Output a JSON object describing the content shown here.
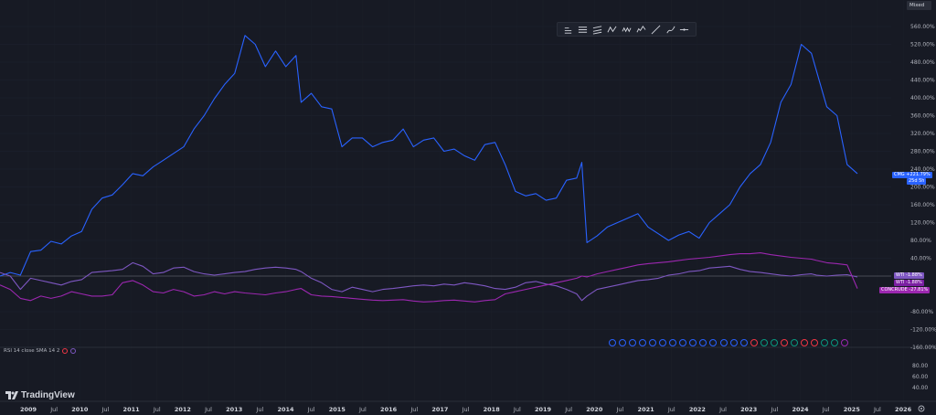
{
  "scale_mode": "Mixed",
  "brand": "TradingView",
  "rsi_legend": "RSI 14 close SMA 14 2",
  "toolbar_icons": [
    "cursor-lines-icon",
    "horizontal-lines-icon",
    "parallel-lines-icon",
    "wave-icon",
    "zigzag-icon",
    "multi-wave-icon",
    "trend-line-icon",
    "brush-icon",
    "hline-icon"
  ],
  "chart_data": {
    "type": "line",
    "price_axis_ticks": [
      "560.00%",
      "520.00%",
      "480.00%",
      "440.00%",
      "400.00%",
      "360.00%",
      "320.00%",
      "280.00%",
      "240.00%",
      "200.00%",
      "160.00%",
      "120.00%",
      "80.00%",
      "40.00%",
      "-80.00%",
      "-120.00%",
      "-160.00%"
    ],
    "rsi_axis_ticks": [
      "80.00",
      "60.00",
      "40.00"
    ],
    "time_labels": [
      "2009",
      "Jul",
      "2010",
      "Jul",
      "2011",
      "Jul",
      "2012",
      "Jul",
      "2013",
      "Jul",
      "2014",
      "Jul",
      "2015",
      "Jul",
      "2016",
      "Jul",
      "2017",
      "Jul",
      "2018",
      "Jul",
      "2019",
      "Jul",
      "2020",
      "Jul",
      "2021",
      "Jul",
      "2022",
      "Jul",
      "2023",
      "Jul",
      "2024",
      "Jul",
      "2025",
      "Jul",
      "2026"
    ],
    "colors": {
      "cmg": "#2962ff",
      "wti1": "#7e57c2",
      "wti2": "#7b1fa2",
      "concrude": "#9c27b0",
      "baseline": "#787b86"
    },
    "series": [
      {
        "name": "CMG",
        "color": "#2962ff",
        "last_label": "+221.79%",
        "countdown": "25d 5h",
        "x": [
          2008.6,
          2008.8,
          2009.0,
          2009.2,
          2009.4,
          2009.6,
          2009.8,
          2010.0,
          2010.2,
          2010.4,
          2010.6,
          2010.8,
          2011.0,
          2011.2,
          2011.4,
          2011.6,
          2011.8,
          2012.0,
          2012.2,
          2012.4,
          2012.6,
          2012.8,
          2013.0,
          2013.2,
          2013.4,
          2013.6,
          2013.8,
          2014.0,
          2014.2,
          2014.4,
          2014.5,
          2014.7,
          2014.9,
          2015.1,
          2015.3,
          2015.5,
          2015.7,
          2015.9,
          2016.1,
          2016.3,
          2016.5,
          2016.7,
          2016.9,
          2017.1,
          2017.3,
          2017.5,
          2017.7,
          2017.9,
          2018.1,
          2018.3,
          2018.5,
          2018.7,
          2018.9,
          2019.1,
          2019.3,
          2019.5,
          2019.7,
          2019.9,
          2020.0,
          2020.1,
          2020.3,
          2020.5,
          2020.7,
          2020.9,
          2021.1,
          2021.3,
          2021.5,
          2021.7,
          2021.9,
          2022.1,
          2022.3,
          2022.5,
          2022.7,
          2022.9,
          2023.1,
          2023.3,
          2023.5,
          2023.7,
          2023.9,
          2024.1,
          2024.3,
          2024.5,
          2024.6,
          2024.8,
          2025.0,
          2025.2,
          2025.4
        ],
        "values": [
          0,
          8,
          2,
          55,
          58,
          78,
          72,
          90,
          100,
          150,
          175,
          182,
          205,
          230,
          225,
          245,
          260,
          275,
          290,
          330,
          360,
          398,
          430,
          455,
          540,
          520,
          470,
          505,
          470,
          495,
          390,
          410,
          380,
          375,
          290,
          310,
          310,
          290,
          300,
          305,
          330,
          290,
          305,
          310,
          280,
          285,
          270,
          260,
          295,
          300,
          250,
          190,
          180,
          185,
          170,
          175,
          215,
          220,
          255,
          75,
          90,
          110,
          120,
          130,
          140,
          110,
          95,
          80,
          92,
          100,
          85,
          120,
          140,
          160,
          200,
          230,
          250,
          300,
          390,
          430,
          520,
          500,
          460,
          380,
          360,
          250,
          230
        ]
      },
      {
        "name": "WTI",
        "color": "#7e57c2",
        "last_label": "-1.88%",
        "x": [
          2008.6,
          2008.8,
          2009.0,
          2009.2,
          2009.4,
          2009.6,
          2009.8,
          2010.0,
          2010.2,
          2010.4,
          2010.6,
          2010.8,
          2011.0,
          2011.2,
          2011.4,
          2011.6,
          2011.8,
          2012.0,
          2012.2,
          2012.4,
          2012.6,
          2012.8,
          2013.0,
          2013.2,
          2013.4,
          2013.6,
          2013.8,
          2014.0,
          2014.2,
          2014.4,
          2014.5,
          2014.7,
          2014.9,
          2015.1,
          2015.3,
          2015.5,
          2015.7,
          2015.9,
          2016.1,
          2016.3,
          2016.5,
          2016.7,
          2016.9,
          2017.1,
          2017.3,
          2017.5,
          2017.7,
          2017.9,
          2018.1,
          2018.3,
          2018.5,
          2018.7,
          2018.9,
          2019.1,
          2019.3,
          2019.5,
          2019.7,
          2019.9,
          2020.0,
          2020.1,
          2020.3,
          2020.5,
          2020.7,
          2020.9,
          2021.1,
          2021.3,
          2021.5,
          2021.7,
          2021.9,
          2022.1,
          2022.3,
          2022.5,
          2022.7,
          2022.9,
          2023.1,
          2023.3,
          2023.5,
          2023.7,
          2023.9,
          2024.1,
          2024.3,
          2024.5,
          2024.6,
          2024.8,
          2025.0,
          2025.2,
          2025.4
        ],
        "values": [
          8,
          0,
          -30,
          -5,
          -10,
          -15,
          -20,
          -12,
          -8,
          8,
          10,
          12,
          15,
          30,
          22,
          5,
          8,
          18,
          20,
          10,
          5,
          2,
          5,
          8,
          10,
          15,
          18,
          20,
          18,
          15,
          10,
          -5,
          -15,
          -30,
          -35,
          -25,
          -30,
          -35,
          -30,
          -28,
          -25,
          -22,
          -20,
          -22,
          -18,
          -20,
          -15,
          -18,
          -22,
          -28,
          -30,
          -25,
          -15,
          -12,
          -18,
          -22,
          -30,
          -40,
          -55,
          -45,
          -30,
          -25,
          -20,
          -15,
          -10,
          -8,
          -5,
          2,
          5,
          10,
          12,
          18,
          20,
          22,
          15,
          10,
          8,
          5,
          2,
          0,
          3,
          5,
          2,
          0,
          2,
          3,
          -2
        ]
      },
      {
        "name": "WTI",
        "color": "#7b1fa2",
        "last_label": "-1.88%"
      },
      {
        "name": "CONCRUDE",
        "color": "#9c27b0",
        "last_label": "-27.81%",
        "x": [
          2008.6,
          2008.8,
          2009.0,
          2009.2,
          2009.4,
          2009.6,
          2009.8,
          2010.0,
          2010.2,
          2010.4,
          2010.6,
          2010.8,
          2011.0,
          2011.2,
          2011.4,
          2011.6,
          2011.8,
          2012.0,
          2012.2,
          2012.4,
          2012.6,
          2012.8,
          2013.0,
          2013.2,
          2013.4,
          2013.6,
          2013.8,
          2014.0,
          2014.2,
          2014.4,
          2014.5,
          2014.7,
          2014.9,
          2015.1,
          2015.3,
          2015.5,
          2015.7,
          2015.9,
          2016.1,
          2016.3,
          2016.5,
          2016.7,
          2016.9,
          2017.1,
          2017.3,
          2017.5,
          2017.7,
          2017.9,
          2018.1,
          2018.3,
          2018.5,
          2018.7,
          2018.9,
          2019.1,
          2019.3,
          2019.5,
          2019.7,
          2019.9,
          2020.0,
          2020.1,
          2020.3,
          2020.5,
          2020.7,
          2020.9,
          2021.1,
          2021.3,
          2021.5,
          2021.7,
          2021.9,
          2022.1,
          2022.3,
          2022.5,
          2022.7,
          2022.9,
          2023.1,
          2023.3,
          2023.5,
          2023.7,
          2023.9,
          2024.1,
          2024.3,
          2024.5,
          2024.6,
          2024.8,
          2025.0,
          2025.2,
          2025.4
        ],
        "values": [
          -20,
          -30,
          -50,
          -55,
          -45,
          -50,
          -45,
          -35,
          -40,
          -45,
          -45,
          -42,
          -15,
          -10,
          -20,
          -35,
          -38,
          -30,
          -35,
          -45,
          -42,
          -35,
          -40,
          -35,
          -38,
          -40,
          -42,
          -38,
          -35,
          -30,
          -28,
          -42,
          -45,
          -46,
          -48,
          -50,
          -52,
          -54,
          -55,
          -54,
          -53,
          -56,
          -58,
          -57,
          -55,
          -54,
          -56,
          -58,
          -55,
          -53,
          -40,
          -35,
          -30,
          -25,
          -20,
          -15,
          -10,
          -5,
          0,
          -2,
          5,
          10,
          15,
          20,
          25,
          28,
          30,
          32,
          35,
          38,
          40,
          42,
          45,
          48,
          50,
          50,
          52,
          48,
          45,
          42,
          40,
          38,
          35,
          30,
          28,
          25,
          -27.81
        ]
      }
    ],
    "rsi_range": [
      0,
      100
    ]
  }
}
